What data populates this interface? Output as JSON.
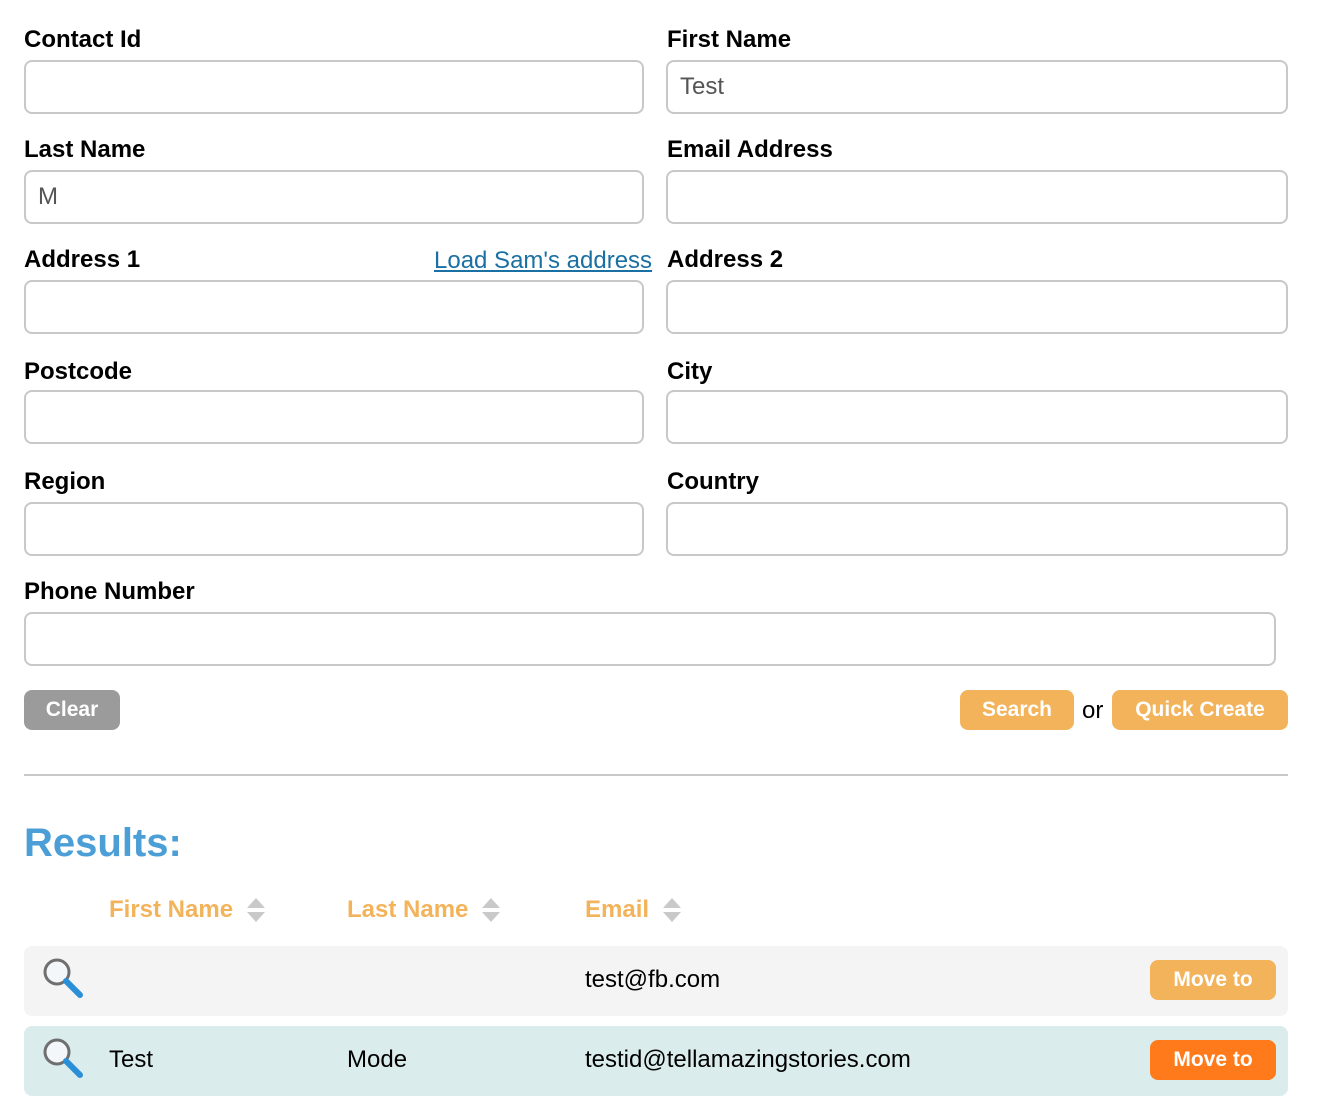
{
  "form": {
    "contact_id": {
      "label": "Contact Id",
      "value": ""
    },
    "first_name": {
      "label": "First Name",
      "value": "Test"
    },
    "last_name": {
      "label": "Last Name",
      "value": "M"
    },
    "email": {
      "label": "Email Address",
      "value": ""
    },
    "address1": {
      "label": "Address 1",
      "value": "",
      "link": "Load Sam's address"
    },
    "address2": {
      "label": "Address 2",
      "value": ""
    },
    "postcode": {
      "label": "Postcode",
      "value": ""
    },
    "city": {
      "label": "City",
      "value": ""
    },
    "region": {
      "label": "Region",
      "value": ""
    },
    "country": {
      "label": "Country",
      "value": ""
    },
    "phone": {
      "label": "Phone Number",
      "value": ""
    }
  },
  "actions": {
    "clear": "Clear",
    "search": "Search",
    "or": "or",
    "quick_create": "Quick Create"
  },
  "results": {
    "title": "Results:",
    "columns": [
      "First Name",
      "Last Name",
      "Email"
    ],
    "rows": [
      {
        "first_name": "",
        "last_name": "",
        "email": "test@fb.com",
        "action": "Move to"
      },
      {
        "first_name": "Test",
        "last_name": "Mode",
        "email": "testid@tellamazingstories.com",
        "action": "Move to"
      }
    ]
  },
  "colors": {
    "accent_orange": "#f2b35b",
    "active_orange": "#ff7a1a",
    "results_blue": "#4c9ed6",
    "link_blue": "#1a6fa3"
  },
  "icons": {
    "row_view": "magnifier-icon",
    "sort": "sort-arrows-icon"
  }
}
